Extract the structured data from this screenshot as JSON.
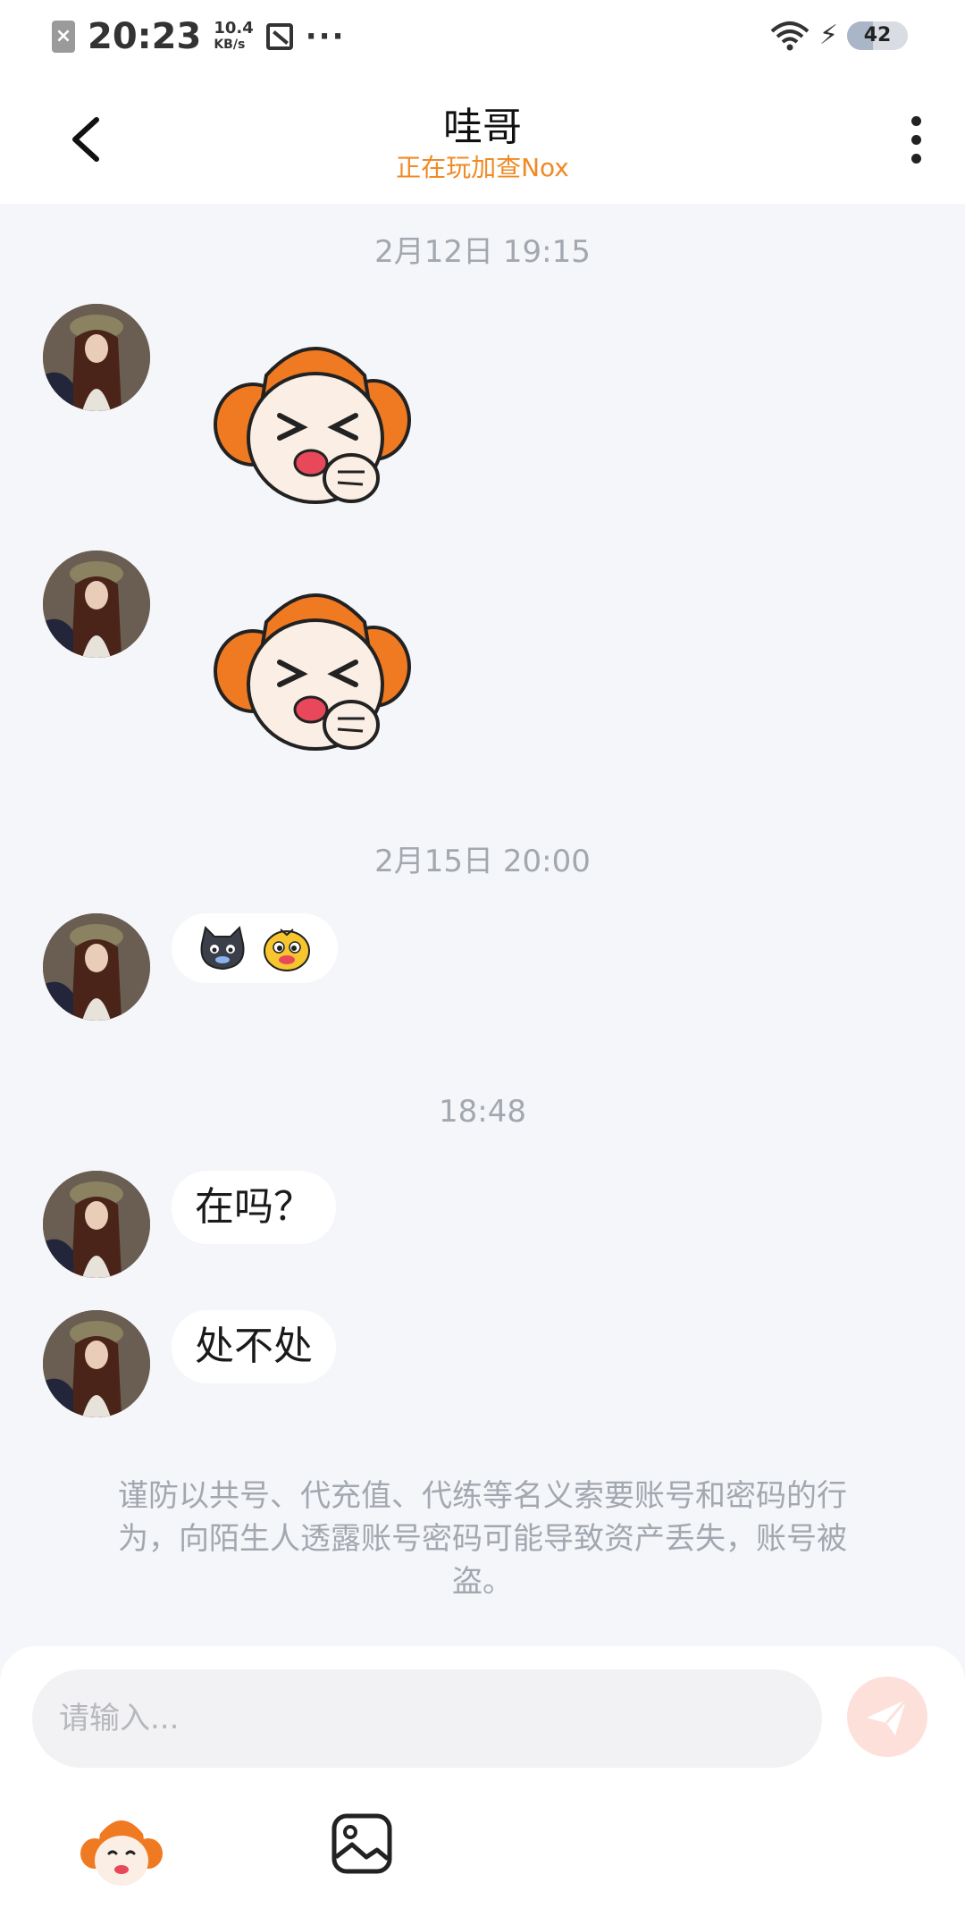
{
  "status_bar": {
    "time": "20:23",
    "speed_value": "10.4",
    "speed_unit": "KB/s",
    "more": "···",
    "battery": "42",
    "battery_level": 0.42,
    "sim_icon": "sim-off-icon",
    "wifi_icon": "wifi-icon",
    "charge_icon": "charging-bolt-icon"
  },
  "header": {
    "title": "哇哥",
    "status": "正在玩加查Nox",
    "accent_color": "#f08a24"
  },
  "messages": {
    "timestamp_1": "2月12日 19:15",
    "timestamp_2": "2月15日 20:00",
    "timestamp_3": "18:48",
    "sticker_1": "monkey-laughing-sticker",
    "sticker_2": "monkey-laughing-sticker",
    "emoji_message": "black-cat-emoji yellow-duck-emoji",
    "text_1": "在吗？",
    "text_2": "处不处"
  },
  "warning": {
    "text": "谨防以共号、代充值、代练等名义索要账号和密码的行为，向陌生人透露账号密码可能导致资产丢失，账号被盗。"
  },
  "composer": {
    "placeholder": "请输入...",
    "send_icon": "send-plane-icon",
    "emoji_icon": "monkey-emoji-icon",
    "image_icon": "image-icon"
  }
}
